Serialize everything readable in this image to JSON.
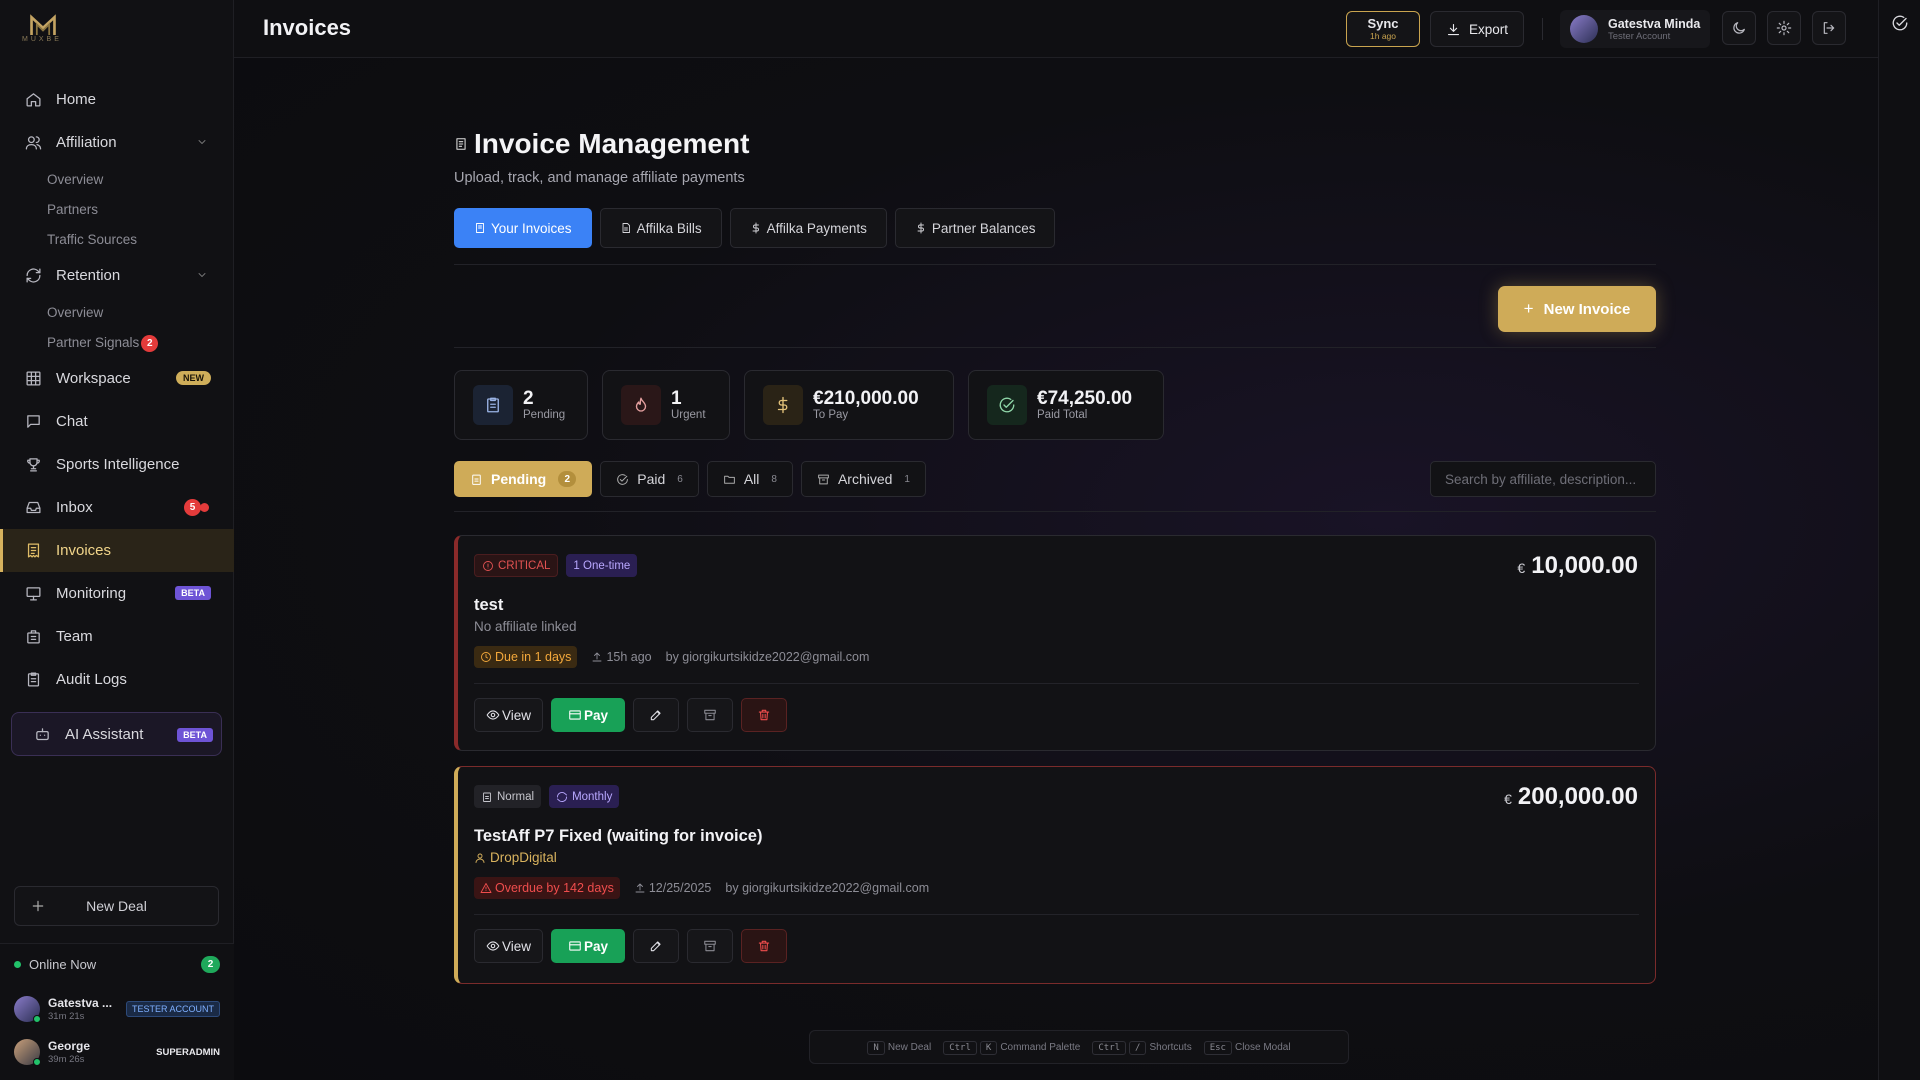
{
  "app": {
    "logo_text": "MUXBE",
    "page_title": "Invoices"
  },
  "header": {
    "sync_label": "Sync",
    "sync_sub": "1h ago",
    "export_label": "Export",
    "user_name": "Gatestva Minda",
    "user_sub": "Tester Account"
  },
  "sidebar": {
    "items": [
      {
        "label": "Home"
      },
      {
        "label": "Affiliation"
      },
      {
        "label": "Overview"
      },
      {
        "label": "Partners"
      },
      {
        "label": "Traffic Sources"
      },
      {
        "label": "Retention"
      },
      {
        "label": "Overview"
      },
      {
        "label": "Partner Signals",
        "badge": "2"
      },
      {
        "label": "Workspace",
        "pill": "NEW"
      },
      {
        "label": "Chat"
      },
      {
        "label": "Sports Intelligence"
      },
      {
        "label": "Inbox",
        "badge": "5"
      },
      {
        "label": "Invoices"
      },
      {
        "label": "Monitoring",
        "pill": "BETA"
      },
      {
        "label": "Team"
      },
      {
        "label": "Audit Logs"
      }
    ],
    "ai_assistant": {
      "label": "AI Assistant",
      "pill": "BETA"
    },
    "new_deal": "New Deal",
    "online": {
      "label": "Online Now",
      "count": "2",
      "users": [
        {
          "name": "Gatestva ...",
          "time": "31m 21s",
          "tag": "TESTER ACCOUNT"
        },
        {
          "name": "George",
          "time": "39m 26s",
          "tag": "SUPERADMIN"
        }
      ]
    }
  },
  "main": {
    "title": "Invoice Management",
    "subtitle": "Upload, track, and manage affiliate payments",
    "tabs": [
      {
        "label": "Your Invoices"
      },
      {
        "label": "Affilka Bills"
      },
      {
        "label": "Affilka Payments"
      },
      {
        "label": "Partner Balances"
      }
    ],
    "new_invoice": "New Invoice",
    "stats": [
      {
        "value": "2",
        "label": "Pending"
      },
      {
        "value": "1",
        "label": "Urgent"
      },
      {
        "value": "€210,000.00",
        "label": "To Pay"
      },
      {
        "value": "€74,250.00",
        "label": "Paid Total"
      }
    ],
    "filters": [
      {
        "label": "Pending",
        "count": "2"
      },
      {
        "label": "Paid",
        "count": "6"
      },
      {
        "label": "All",
        "count": "8"
      },
      {
        "label": "Archived",
        "count": "1"
      }
    ],
    "search_placeholder": "Search by affiliate, description...",
    "invoices": [
      {
        "priority": "CRITICAL",
        "type": "1 One-time",
        "currency": "€",
        "amount": "10,000.00",
        "title": "test",
        "affiliate": "No affiliate linked",
        "due": "Due in 1 days",
        "uploaded": "15h ago",
        "by": "by giorgikurtsikidze2022@gmail.com",
        "view": "View",
        "pay": "Pay"
      },
      {
        "priority": "Normal",
        "type": "Monthly",
        "currency": "€",
        "amount": "200,000.00",
        "title": "TestAff P7 Fixed (waiting for invoice)",
        "affiliate": "DropDigital",
        "due": "Overdue by 142 days",
        "uploaded": "12/25/2025",
        "by": "by giorgikurtsikidze2022@gmail.com",
        "view": "View",
        "pay": "Pay"
      }
    ]
  },
  "shortcuts": [
    {
      "key": "N",
      "label": "New Deal"
    },
    {
      "key": "Ctrl",
      "key2": "K",
      "label": "Command Palette"
    },
    {
      "key": "Ctrl",
      "key2": "/",
      "label": "Shortcuts"
    },
    {
      "key": "Esc",
      "label": "Close Modal"
    }
  ]
}
